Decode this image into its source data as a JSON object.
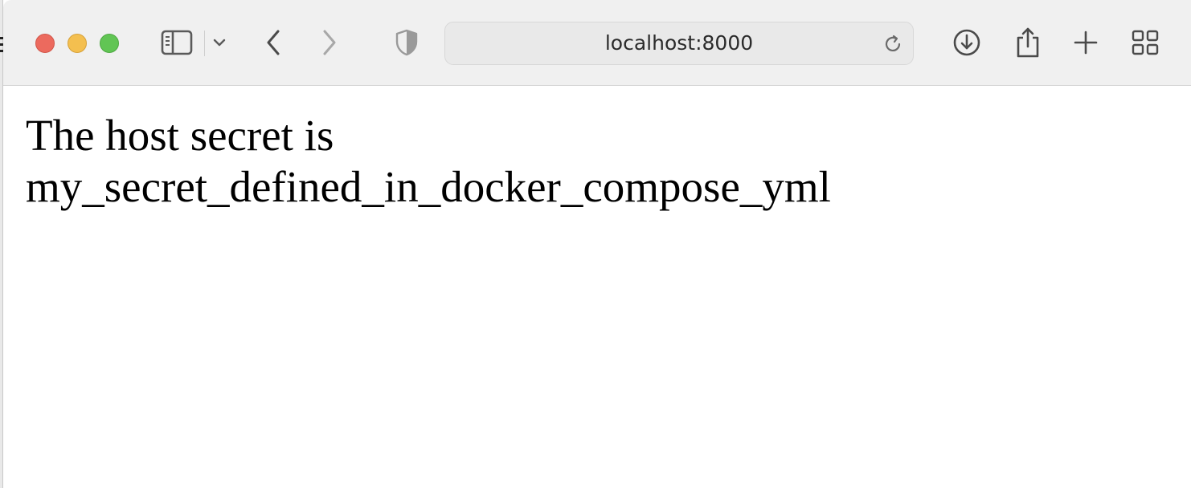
{
  "browser": {
    "url": "localhost:8000",
    "toolbar_icons": [
      "sidebar-icon",
      "chevron-down-icon",
      "back-arrow-icon",
      "forward-arrow-icon",
      "shield-icon",
      "reload-icon",
      "download-icon",
      "share-icon",
      "plus-icon",
      "tab-grid-icon"
    ]
  },
  "page": {
    "line1": "The host secret is",
    "line2": "my_secret_defined_in_docker_compose_yml"
  },
  "colors": {
    "toolbar_bg": "#f0f0f0",
    "close": "#ec6a5e",
    "minimize": "#f4bf4f",
    "maximize": "#61c554",
    "icon": "#5a5a5a",
    "icon_disabled": "#a8a8a8"
  }
}
